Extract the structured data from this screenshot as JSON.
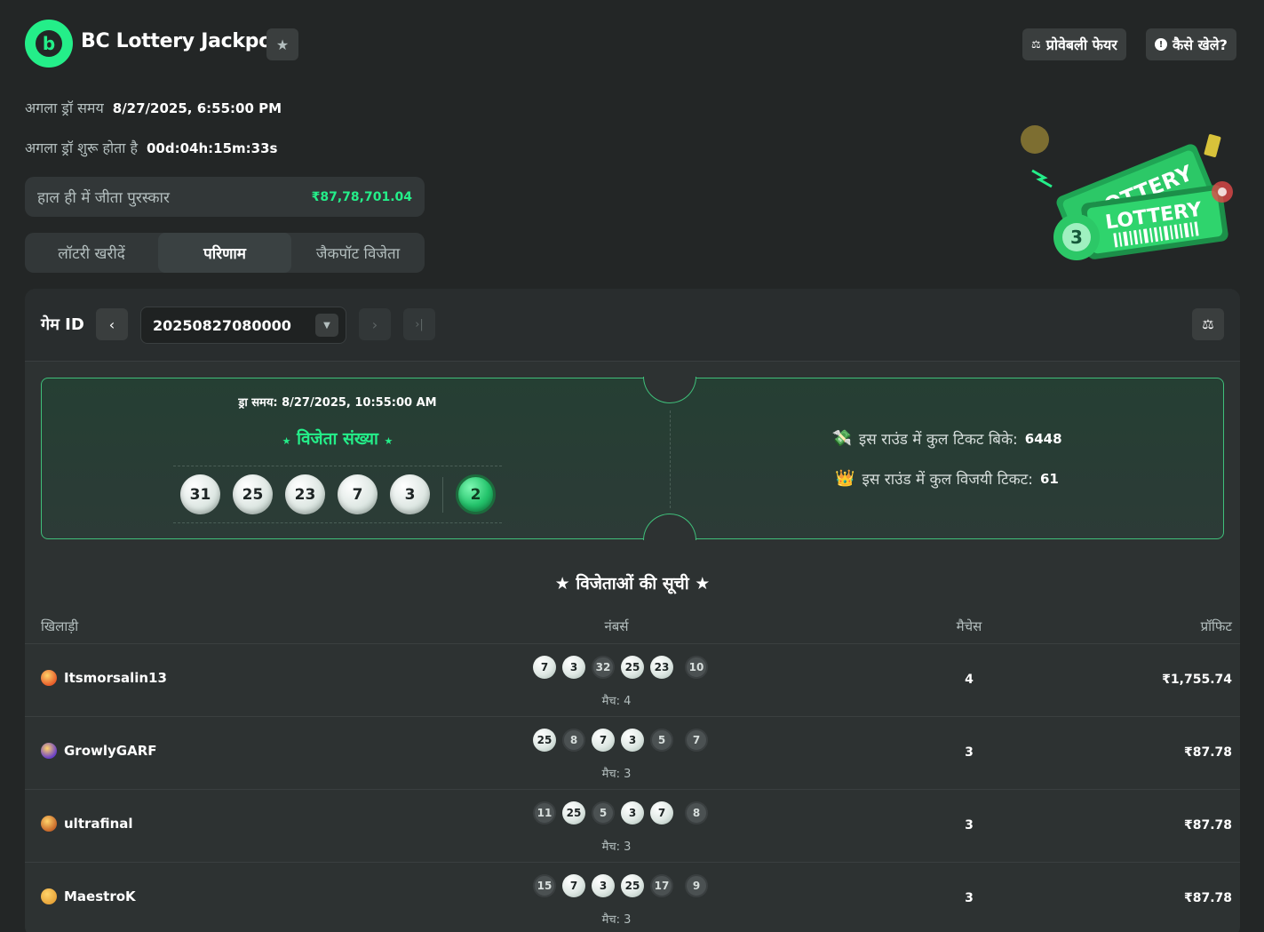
{
  "header": {
    "title": "BC Lottery Jackpot",
    "provably_fair": "प्रोवेबली फेयर",
    "how_to_play": "कैसे खेले?"
  },
  "info": {
    "next_draw_label": "अगला ड्रॉ समय",
    "next_draw_value": "8/27/2025, 6:55:00 PM",
    "countdown_label": "अगला ड्रॉ शुरू होता है",
    "countdown_value": "00d:04h:15m:33s"
  },
  "prize": {
    "label": "हाल ही में जीता पुरस्कार",
    "value": "₹87,78,701.04"
  },
  "tabs": [
    "लॉटरी खरीदें",
    "परिणाम",
    "जैकपॉट विजेता"
  ],
  "game": {
    "label": "गेम ID",
    "id": "20250827080000"
  },
  "ticket": {
    "draw_time": "ड्रा समय: 8/27/2025, 10:55:00 AM",
    "title": "विजेता संख्या",
    "numbers": [
      "31",
      "25",
      "23",
      "7",
      "3"
    ],
    "jackpot": "2",
    "sold_label": "इस राउंड में कुल टिकट बिके:",
    "sold_value": "6448",
    "winning_label": "इस राउंड में कुल विजयी टिकट:",
    "winning_value": "61"
  },
  "winners": {
    "title": "विजेताओं की सूची",
    "columns": [
      "खिलाड़ी",
      "नंबर्स",
      "मैचेस",
      "प्रॉफिट"
    ],
    "rows": [
      {
        "player": "Itsmorsalin13",
        "balls": [
          [
            "7",
            true
          ],
          [
            "3",
            true
          ],
          [
            "32",
            false
          ],
          [
            "25",
            true
          ],
          [
            "23",
            true
          ],
          [
            "10",
            false
          ]
        ],
        "match_label": "मैच: 4",
        "matches": "4",
        "profit": "₹1,755.74",
        "avatar": "#e85d2a"
      },
      {
        "player": "GrowlyGARF",
        "balls": [
          [
            "25",
            true
          ],
          [
            "8",
            false
          ],
          [
            "7",
            true
          ],
          [
            "3",
            true
          ],
          [
            "5",
            false
          ],
          [
            "7",
            false
          ]
        ],
        "match_label": "मैच: 3",
        "matches": "3",
        "profit": "₹87.78",
        "avatar": "#6a3fc8"
      },
      {
        "player": "ultrafinal",
        "balls": [
          [
            "11",
            false
          ],
          [
            "25",
            true
          ],
          [
            "5",
            false
          ],
          [
            "3",
            true
          ],
          [
            "7",
            true
          ],
          [
            "8",
            false
          ]
        ],
        "match_label": "मैच: 3",
        "matches": "3",
        "profit": "₹87.78",
        "avatar": "#c8682a"
      },
      {
        "player": "MaestroK",
        "balls": [
          [
            "15",
            false
          ],
          [
            "7",
            true
          ],
          [
            "3",
            true
          ],
          [
            "25",
            true
          ],
          [
            "17",
            false
          ],
          [
            "9",
            false
          ]
        ],
        "match_label": "मैच: 3",
        "matches": "3",
        "profit": "₹87.78",
        "avatar": "#e8a53a"
      }
    ]
  },
  "colors": {
    "accent": "#24ee89",
    "bg": "#232626",
    "panel": "#2d3232"
  }
}
